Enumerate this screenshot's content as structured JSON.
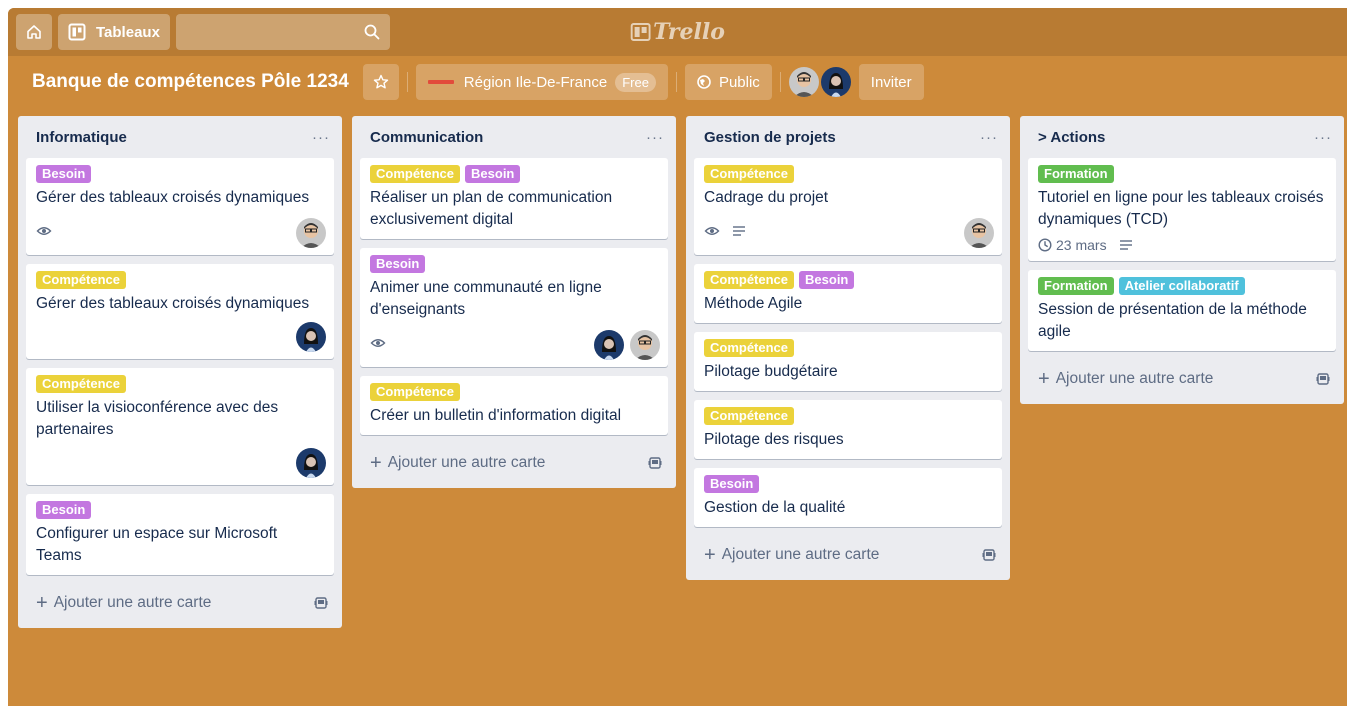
{
  "nav": {
    "boards_label": "Tableaux",
    "search_placeholder": "",
    "logo_text": "Trello"
  },
  "board": {
    "title": "Banque de compétences Pôle 1234",
    "team_name": "Région Ile-De-France",
    "team_badge": "Free",
    "visibility": "Public",
    "invite_label": "Inviter",
    "background_color": "#cd8a3a"
  },
  "colors": {
    "yellow": "#ebd23a",
    "purple": "#c377e0",
    "green": "#61bd4f",
    "sky": "#4fc1dc"
  },
  "add_card_label": "Ajouter une autre carte",
  "lists": [
    {
      "title": "Informatique",
      "cards": [
        {
          "labels": [
            "Besoin"
          ],
          "title": "Gérer des tableaux croisés dynamiques",
          "watch": true
        },
        {
          "labels": [
            "Compétence"
          ],
          "title": "Gérer des tableaux croisés dynamiques"
        },
        {
          "labels": [
            "Compétence"
          ],
          "title": "Utiliser la visioconférence avec des partenaires"
        },
        {
          "labels": [
            "Besoin"
          ],
          "title": "Configurer un espace sur Microsoft Teams"
        }
      ]
    },
    {
      "title": "Communication",
      "cards": [
        {
          "labels": [
            "Compétence",
            "Besoin"
          ],
          "title": "Réaliser un plan de communication exclusivement digital"
        },
        {
          "labels": [
            "Besoin"
          ],
          "title": "Animer une communauté en ligne d'enseignants",
          "watch": true
        },
        {
          "labels": [
            "Compétence"
          ],
          "title": "Créer un bulletin d'information digital"
        }
      ]
    },
    {
      "title": "Gestion de projets",
      "cards": [
        {
          "labels": [
            "Compétence"
          ],
          "title": "Cadrage du projet",
          "watch": true,
          "description": true
        },
        {
          "labels": [
            "Compétence",
            "Besoin"
          ],
          "title": "Méthode Agile"
        },
        {
          "labels": [
            "Compétence"
          ],
          "title": "Pilotage budgétaire"
        },
        {
          "labels": [
            "Compétence"
          ],
          "title": "Pilotage des risques"
        },
        {
          "labels": [
            "Besoin"
          ],
          "title": "Gestion de la qualité"
        }
      ]
    },
    {
      "title": "> Actions",
      "cards": [
        {
          "labels": [
            "Formation"
          ],
          "title": "Tutoriel en ligne pour les tableaux croisés dynamiques (TCD)",
          "due": "23 mars",
          "description": true
        },
        {
          "labels": [
            "Formation",
            "Atelier collaboratif"
          ],
          "title": "Session de présentation de la méthode agile"
        }
      ]
    }
  ]
}
